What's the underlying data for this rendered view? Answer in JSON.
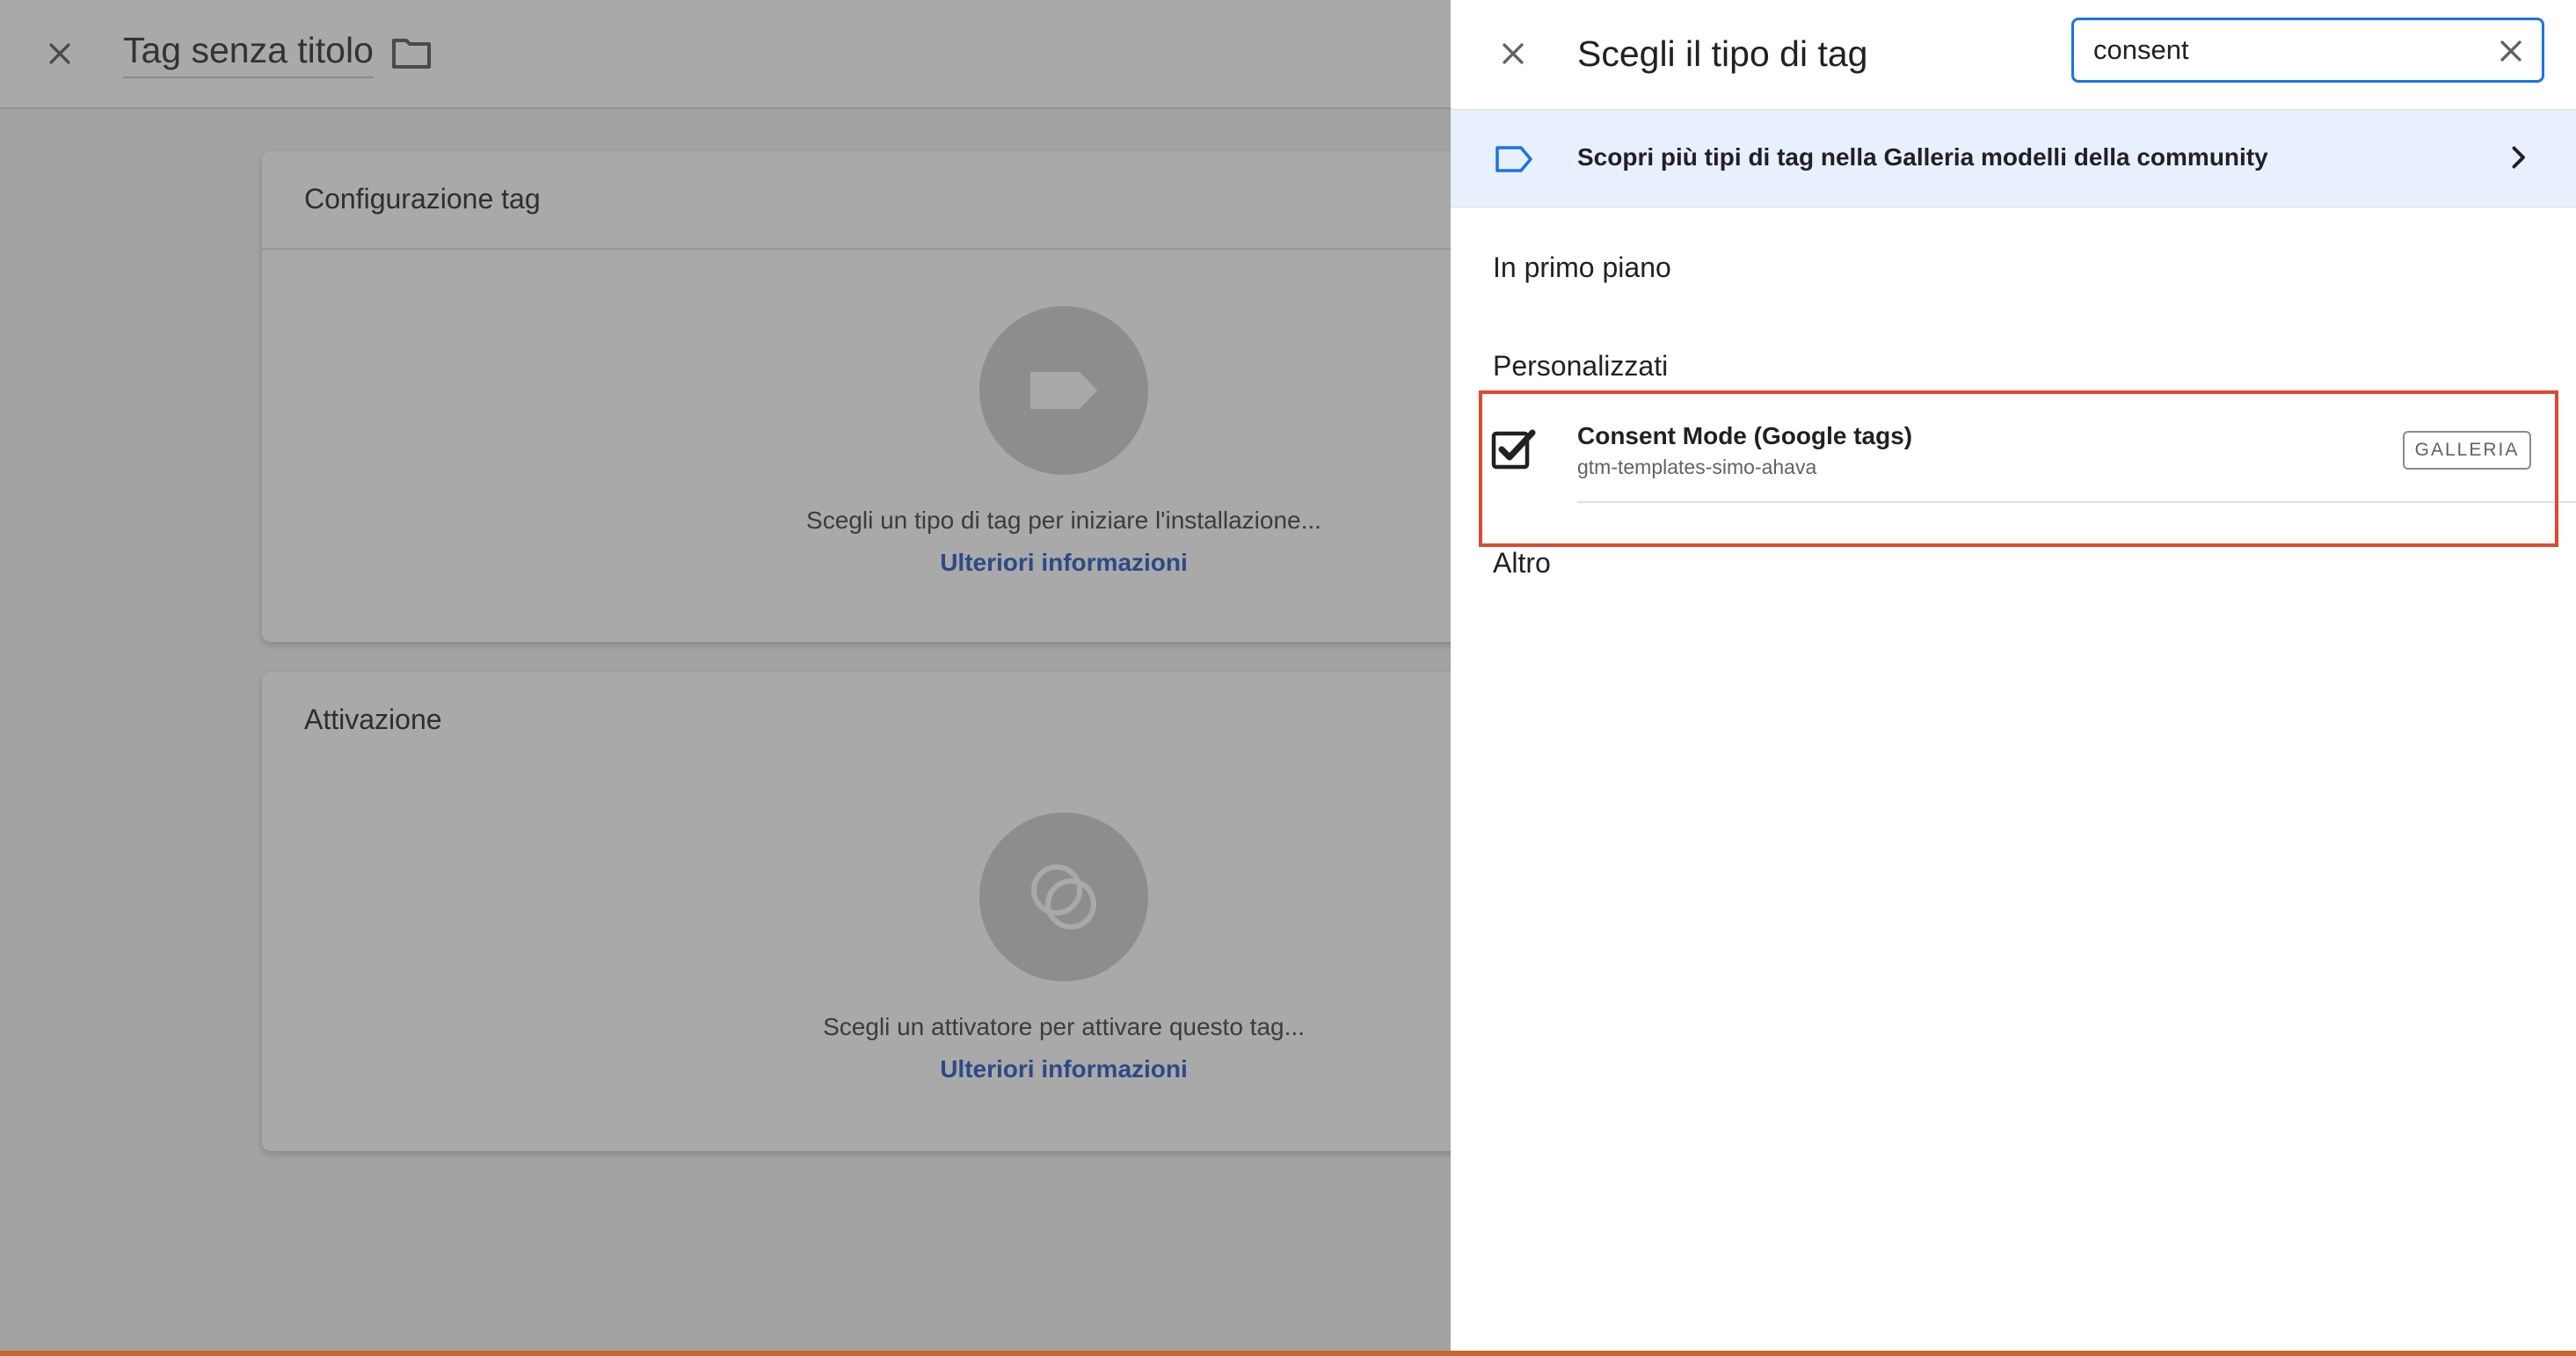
{
  "editor": {
    "title": "Tag senza titolo",
    "config_card": {
      "title": "Configurazione tag",
      "prompt": "Scegli un tipo di tag per iniziare l'installazione...",
      "link": "Ulteriori informazioni"
    },
    "trigger_card": {
      "title": "Attivazione",
      "prompt": "Scegli un attivatore per attivare questo tag...",
      "link": "Ulteriori informazioni"
    }
  },
  "panel": {
    "title": "Scegli il tipo di tag",
    "search": {
      "value": "consent"
    },
    "gallery_banner": {
      "text": "Scopri più tipi di tag nella Galleria modelli della community"
    },
    "sections": {
      "featured": "In primo piano",
      "custom": "Personalizzati",
      "other": "Altro"
    },
    "result": {
      "name": "Consent Mode (Google tags)",
      "publisher": "gtm-templates-simo-ahava",
      "badge": "GALLERIA"
    }
  },
  "colors": {
    "accent_blue": "#1a73e8",
    "banner_bg": "#e8f0fd",
    "highlight": "#e2472f",
    "overlay": "#a3a3a3"
  }
}
